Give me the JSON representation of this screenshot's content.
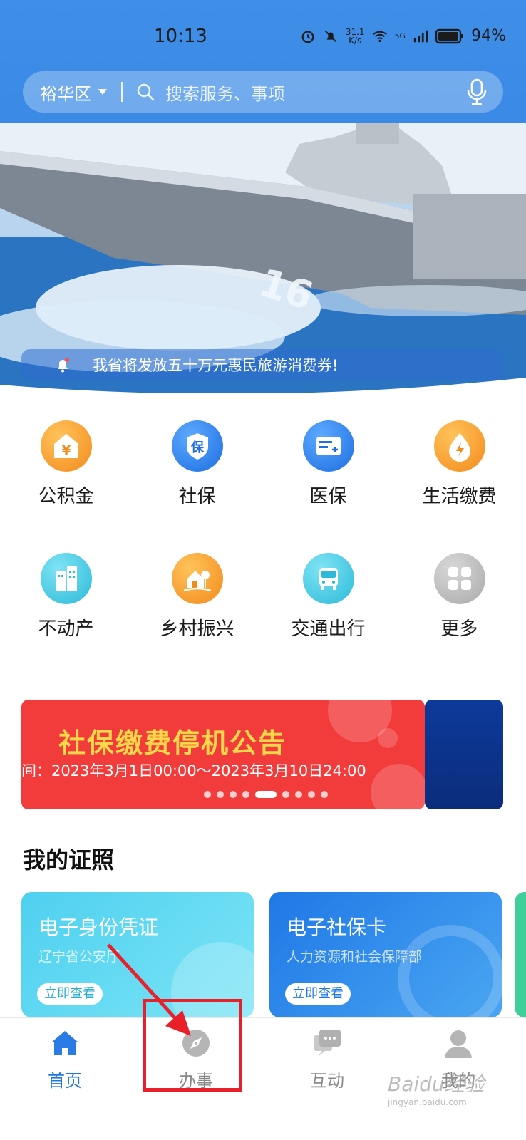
{
  "status_bar": {
    "time": "10:13",
    "speed_top": "31.1",
    "speed_bottom": "K/s",
    "network": "5G",
    "battery": "94%"
  },
  "search": {
    "region": "裕华区",
    "placeholder": "搜索服务、事项"
  },
  "banner": {
    "notice": "我省将发放五十万元惠民旅游消费券!"
  },
  "services": [
    {
      "label": "公积金",
      "icon": "housing-fund-icon",
      "color": "#f38a1c"
    },
    {
      "label": "社保",
      "icon": "social-security-icon",
      "color": "#1e6ee0"
    },
    {
      "label": "医保",
      "icon": "medical-insurance-icon",
      "color": "#1e6ee0"
    },
    {
      "label": "生活缴费",
      "icon": "utility-payment-icon",
      "color": "#f38a1c"
    },
    {
      "label": "不动产",
      "icon": "real-estate-icon",
      "color": "#2cbad8"
    },
    {
      "label": "乡村振兴",
      "icon": "rural-revitalization-icon",
      "color": "#f38a1c"
    },
    {
      "label": "交通出行",
      "icon": "transport-icon",
      "color": "#2cbad8"
    },
    {
      "label": "更多",
      "icon": "more-icon",
      "color": "#a9a9a9"
    }
  ],
  "promo": {
    "title": "社保缴费停机公告",
    "subtitle": "间：2023年3月1日00:00～2023年3月10日24:00",
    "active_slide": 4,
    "slide_count": 9
  },
  "certificates": {
    "title": "我的证照",
    "cards": [
      {
        "title": "电子身份凭证",
        "issuer": "辽宁省公安厅",
        "button": "立即查看"
      },
      {
        "title": "电子社保卡",
        "issuer": "人力资源和社会保障部",
        "button": "立即查看"
      }
    ]
  },
  "nav": {
    "items": [
      {
        "label": "首页",
        "icon": "home-icon",
        "active": true
      },
      {
        "label": "办事",
        "icon": "compass-icon",
        "active": false
      },
      {
        "label": "互动",
        "icon": "chat-icon",
        "active": false
      },
      {
        "label": "我的",
        "icon": "profile-icon",
        "active": false
      }
    ]
  },
  "watermark": {
    "text": "Baidu经验",
    "url": "jingyan.baidu.com"
  }
}
